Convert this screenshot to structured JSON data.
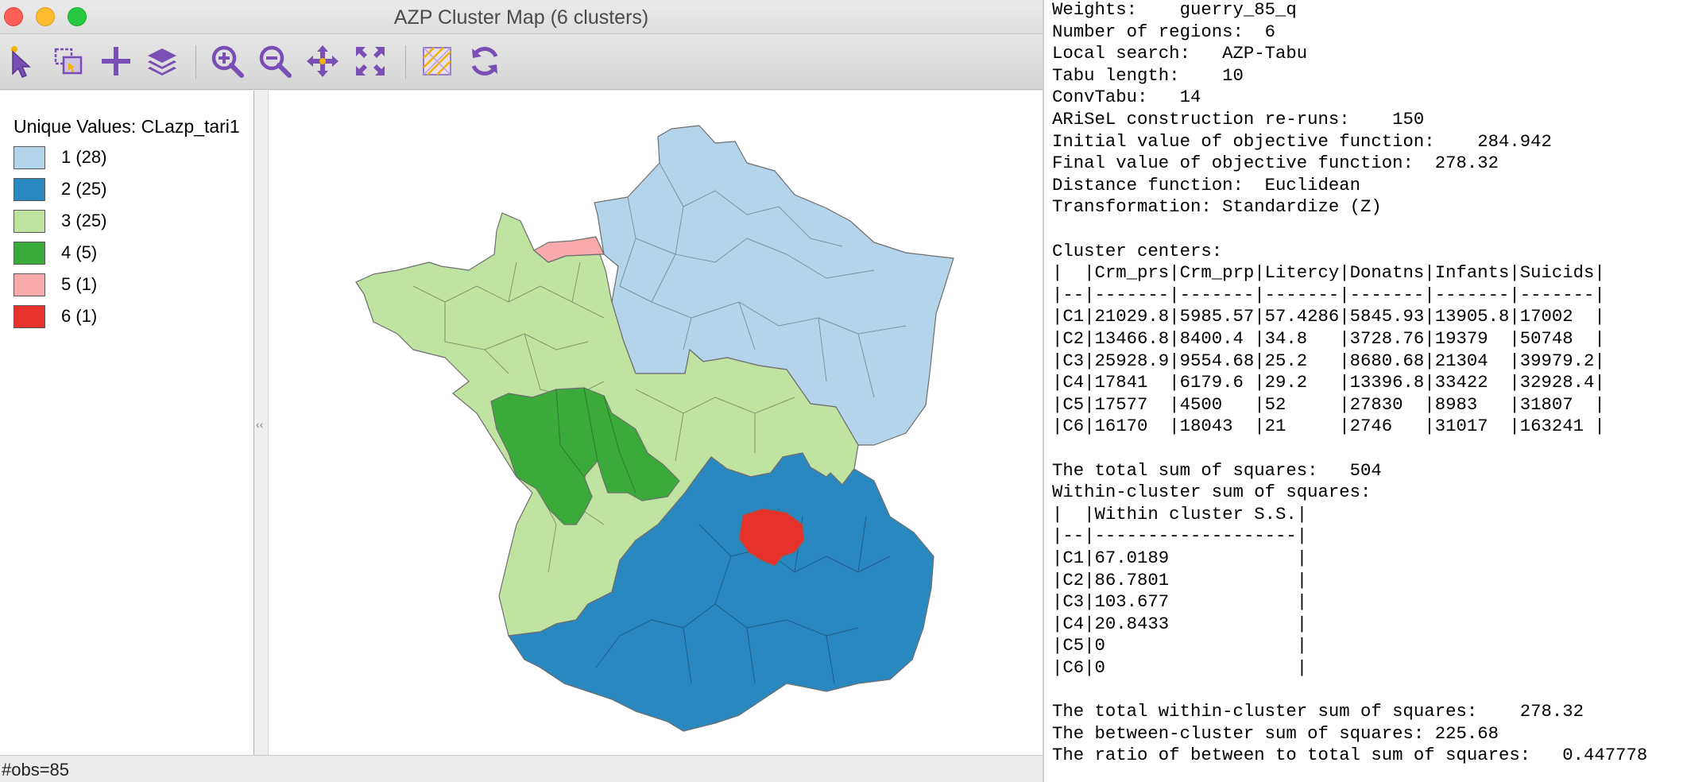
{
  "window": {
    "title": "AZP Cluster Map (6 clusters)"
  },
  "toolbar": {
    "tools": [
      {
        "name": "select-icon"
      },
      {
        "name": "selection-shape-icon"
      },
      {
        "name": "add-icon"
      },
      {
        "name": "layers-icon"
      },
      {
        "name": "zoom-in-icon"
      },
      {
        "name": "zoom-out-icon"
      },
      {
        "name": "pan-icon"
      },
      {
        "name": "fit-to-window-icon"
      },
      {
        "name": "basemap-icon"
      },
      {
        "name": "refresh-icon"
      }
    ]
  },
  "legend": {
    "title": "Unique Values: CLazp_tari1",
    "items": [
      {
        "label": "1 (28)",
        "color": "#b3d4ea"
      },
      {
        "label": "2 (25)",
        "color": "#2a88c1"
      },
      {
        "label": "3 (25)",
        "color": "#bfe3a1"
      },
      {
        "label": "4 (5)",
        "color": "#3aaa3a"
      },
      {
        "label": "5 (1)",
        "color": "#f9abab"
      },
      {
        "label": "6 (1)",
        "color": "#e6322a"
      }
    ]
  },
  "status": {
    "obs": "#obs=85"
  },
  "report": {
    "lines": [
      "Weights:    guerry_85_q",
      "Number of regions:  6",
      "Local search:   AZP-Tabu",
      "Tabu length:    10",
      "ConvTabu:   14",
      "ARiSeL construction re-runs:    150",
      "Initial value of objective function:    284.942",
      "Final value of objective function:  278.32",
      "Distance function:  Euclidean",
      "Transformation: Standardize (Z)",
      "",
      "Cluster centers:",
      "|  |Crm_prs|Crm_prp|Litercy|Donatns|Infants|Suicids|",
      "|--|-------|-------|-------|-------|-------|-------|",
      "|C1|21029.8|5985.57|57.4286|5845.93|13905.8|17002  |",
      "|C2|13466.8|8400.4 |34.8   |3728.76|19379  |50748  |",
      "|C3|25928.9|9554.68|25.2   |8680.68|21304  |39979.2|",
      "|C4|17841  |6179.6 |29.2   |13396.8|33422  |32928.4|",
      "|C5|17577  |4500   |52     |27830  |8983   |31807  |",
      "|C6|16170  |18043  |21     |2746   |31017  |163241 |",
      "",
      "The total sum of squares:   504",
      "Within-cluster sum of squares:",
      "|  |Within cluster S.S.|",
      "|--|-------------------|",
      "|C1|67.0189            |",
      "|C2|86.7801            |",
      "|C3|103.677            |",
      "|C4|20.8433            |",
      "|C5|0                  |",
      "|C6|0                  |",
      "",
      "The total within-cluster sum of squares:    278.32",
      "The between-cluster sum of squares: 225.68",
      "The ratio of between to total sum of squares:   0.447778"
    ]
  }
}
